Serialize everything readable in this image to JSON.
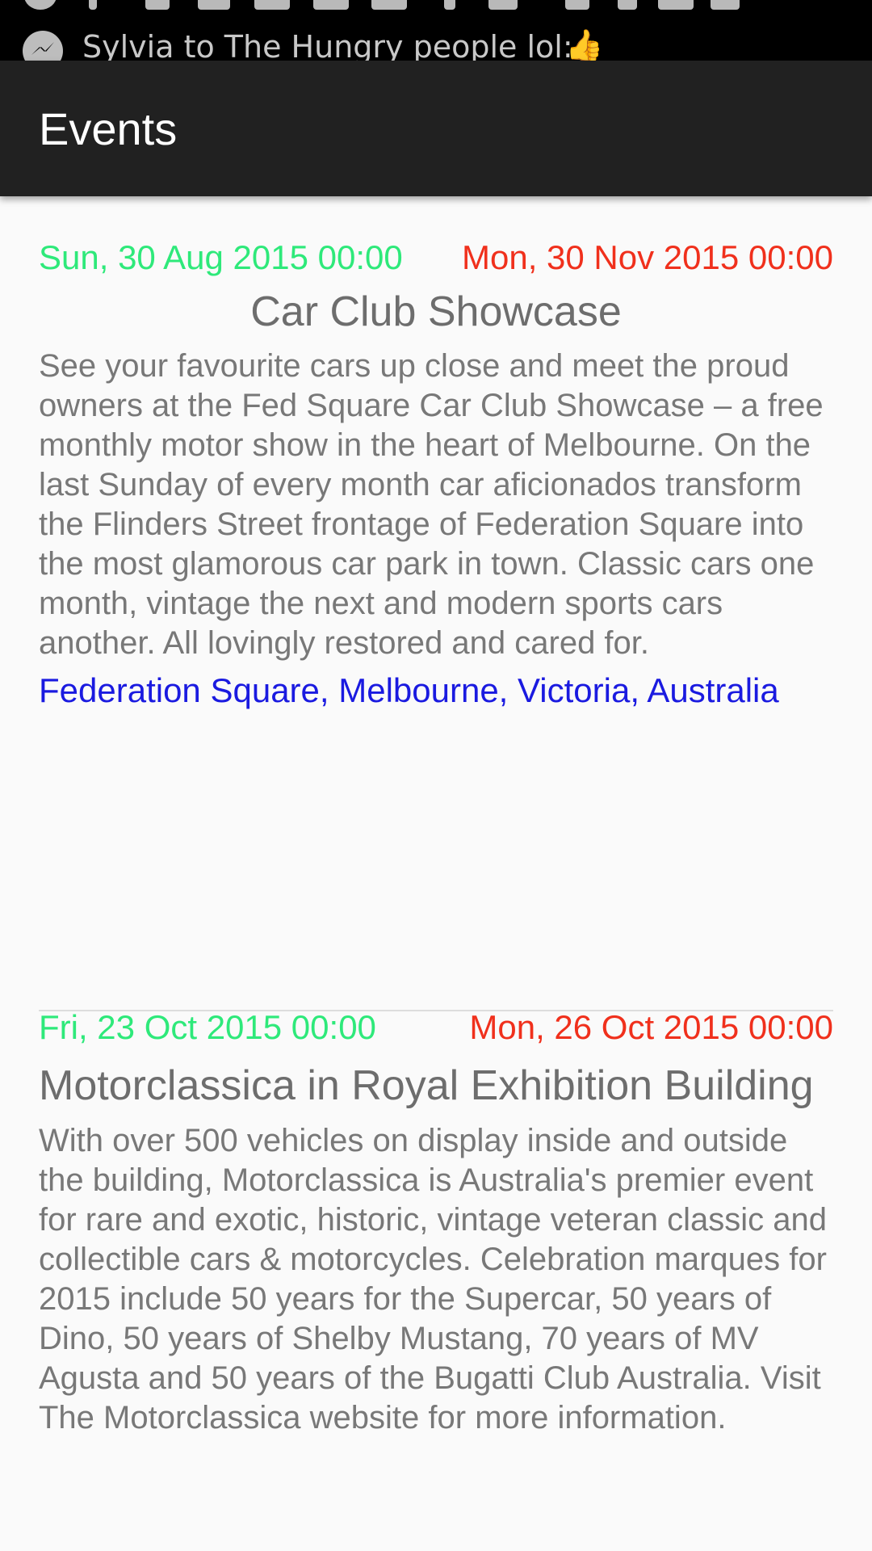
{
  "status_bar": {
    "notification": {
      "text": "Sylvia to The Hungry people lol:",
      "icon": "messenger-icon",
      "emoji": "👍"
    }
  },
  "app_bar": {
    "title": "Events"
  },
  "events": [
    {
      "start": "Sun, 30 Aug 2015 00:00",
      "end": "Mon, 30 Nov 2015 00:00",
      "title": "Car Club Showcase",
      "description": "See your favourite cars up close and meet the proud owners at the Fed Square Car Club Showcase – a free monthly motor show in the heart of Melbourne. On the last Sunday of every month car aficionados transform the Flinders Street frontage of Federation Square into the most glamorous car park in town. Classic cars one month, vintage the next and modern sports cars another. All lovingly restored and cared for.",
      "location": "Federation Square, Melbourne, Victoria, Australia"
    },
    {
      "start": "Fri, 23 Oct 2015 00:00",
      "end": "Mon, 26 Oct 2015 00:00",
      "title": "Motorclassica in Royal Exhibition Building",
      "description": "With over 500 vehicles on display inside and outside the building, Motorclassica is Australia's premier event for rare and exotic, historic, vintage veteran classic and collectible cars & motorcycles. Celebration marques for 2015 include 50 years for the Supercar, 50 years of Dino, 50 years of Shelby Mustang, 70 years of MV Agusta and 50 years of the Bugatti Club Australia. Visit The Motorclassica website for more information."
    }
  ],
  "colors": {
    "start_date": "#2ee97a",
    "end_date": "#f0301c",
    "location": "#1a1ae0",
    "app_bar": "#212121"
  }
}
